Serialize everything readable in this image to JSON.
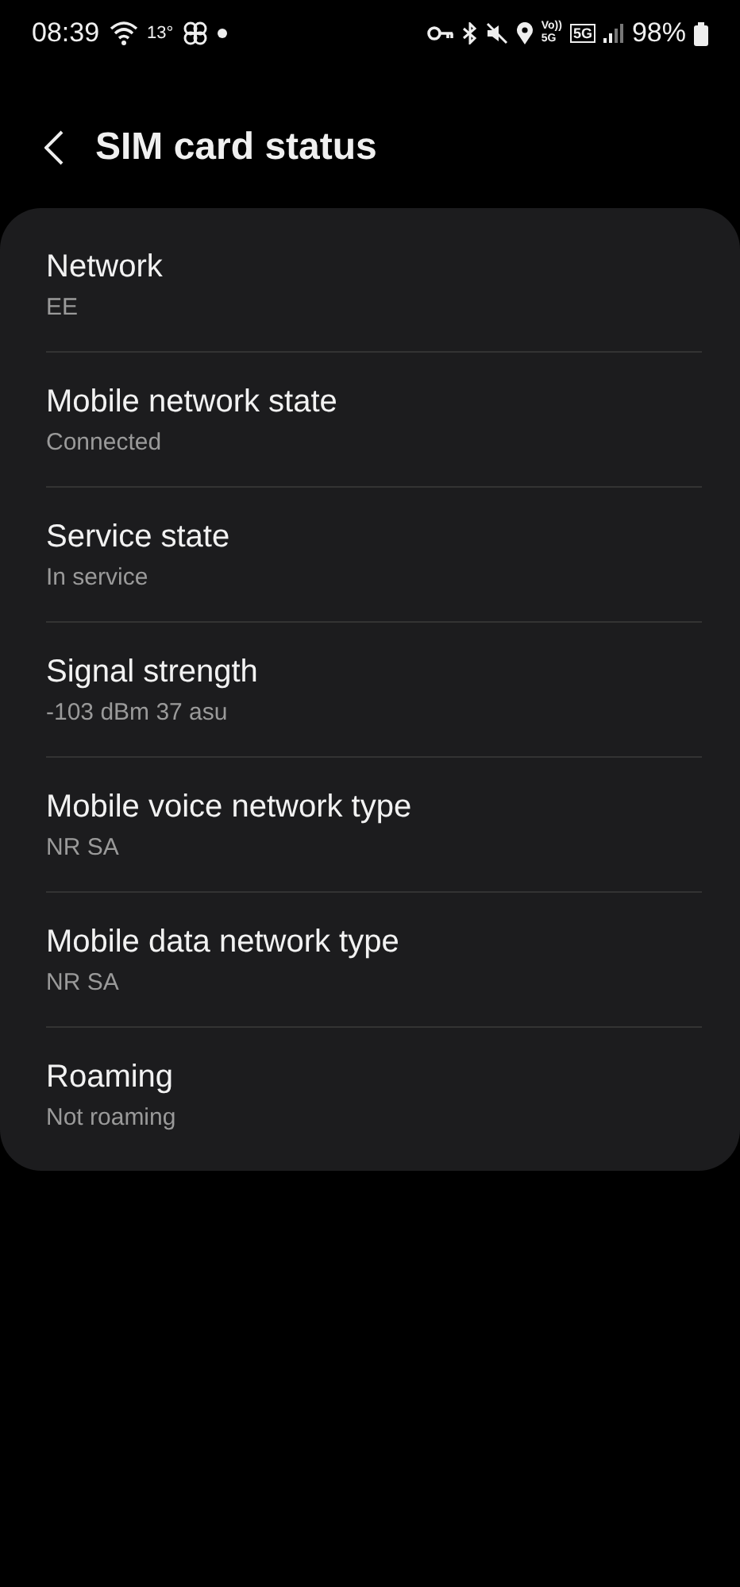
{
  "status_bar": {
    "time": "08:39",
    "temperature": "13°",
    "volte": [
      "Vo))",
      "5G"
    ],
    "data_type": "5G",
    "battery": "98%"
  },
  "header": {
    "title": "SIM card status"
  },
  "items": [
    {
      "title": "Network",
      "value": "EE"
    },
    {
      "title": "Mobile network state",
      "value": "Connected"
    },
    {
      "title": "Service state",
      "value": "In service"
    },
    {
      "title": "Signal strength",
      "value": "-103 dBm 37 asu"
    },
    {
      "title": "Mobile voice network type",
      "value": "NR SA"
    },
    {
      "title": "Mobile data network type",
      "value": "NR SA"
    },
    {
      "title": "Roaming",
      "value": "Not roaming"
    }
  ]
}
